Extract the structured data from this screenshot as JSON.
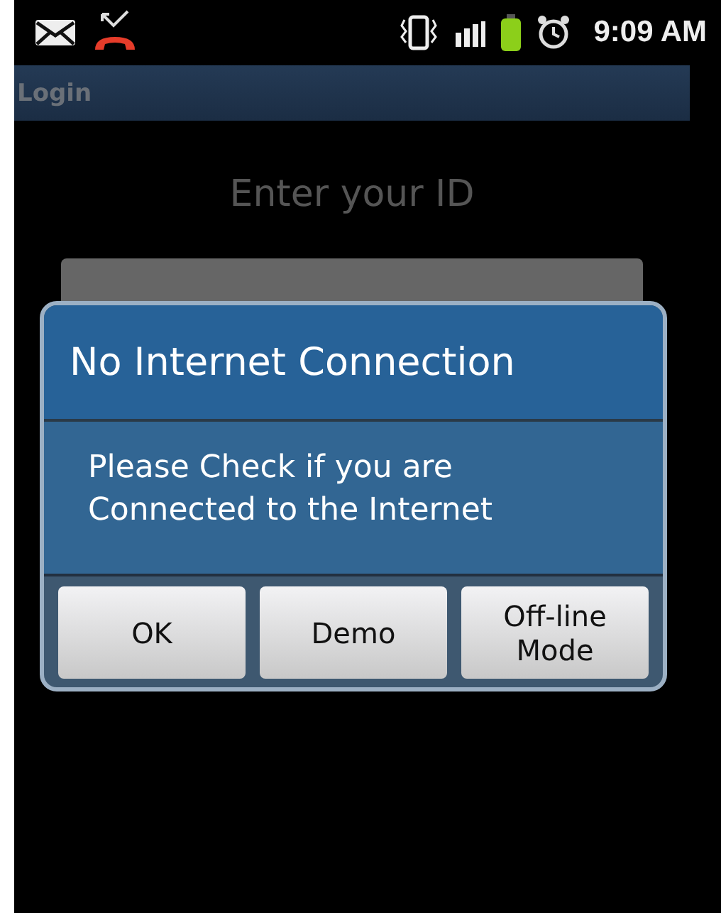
{
  "status_bar": {
    "time": "9:09 AM"
  },
  "title_bar": {
    "title": "Login"
  },
  "login": {
    "prompt": "Enter your ID"
  },
  "dialog": {
    "title": "No Internet Connection",
    "message": "Please Check if you are Connected to the Internet",
    "buttons": [
      {
        "label": "OK"
      },
      {
        "label": "Demo"
      },
      {
        "label": "Off-line Mode"
      }
    ]
  }
}
